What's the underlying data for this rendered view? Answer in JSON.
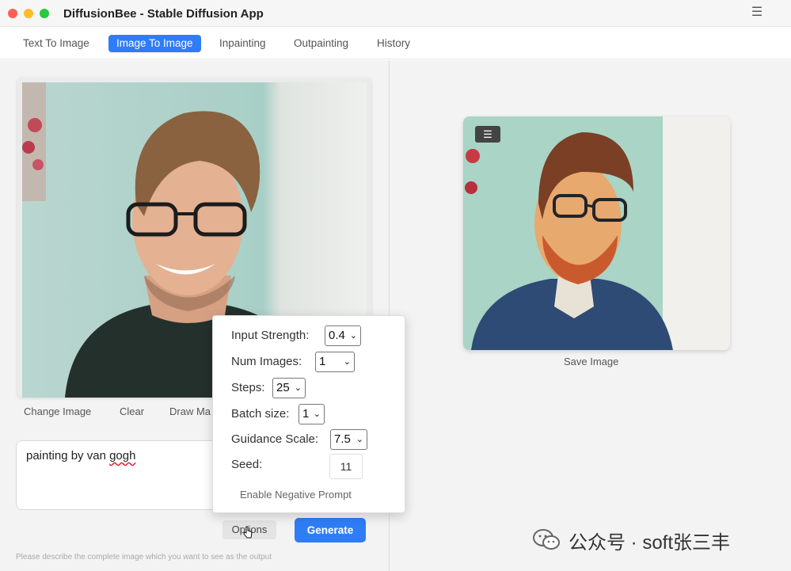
{
  "window": {
    "title": "DiffusionBee - Stable Diffusion App"
  },
  "tabs": [
    {
      "label": "Text To Image",
      "active": false
    },
    {
      "label": "Image To Image",
      "active": true
    },
    {
      "label": "Inpainting",
      "active": false
    },
    {
      "label": "Outpainting",
      "active": false
    },
    {
      "label": "History",
      "active": false
    }
  ],
  "input_image": {
    "actions": {
      "change": "Change Image",
      "clear": "Clear",
      "draw": "Draw Ma"
    }
  },
  "prompt": {
    "text_prefix": "painting by van ",
    "text_misspelled": "gogh",
    "hint": "Please describe the complete image which you want to see as the output"
  },
  "options": {
    "input_strength": {
      "label": "Input Strength:",
      "value": "0.4"
    },
    "num_images": {
      "label": "Num Images:",
      "value": "1"
    },
    "steps": {
      "label": "Steps:",
      "value": "25"
    },
    "batch_size": {
      "label": "Batch size:",
      "value": "1"
    },
    "guidance_scale": {
      "label": "Guidance Scale:",
      "value": "7.5"
    },
    "seed": {
      "label": "Seed:",
      "value": "11"
    },
    "negative_prompt_label": "Enable Negative Prompt"
  },
  "buttons": {
    "options": "Options",
    "generate": "Generate"
  },
  "output": {
    "save_label": "Save Image",
    "menu_glyph": "☰"
  },
  "icons": {
    "window_menu": "☰",
    "chevron": "⌄"
  },
  "watermark": {
    "text": "公众号 · soft张三丰"
  },
  "colors": {
    "accent": "#2f7df6"
  }
}
